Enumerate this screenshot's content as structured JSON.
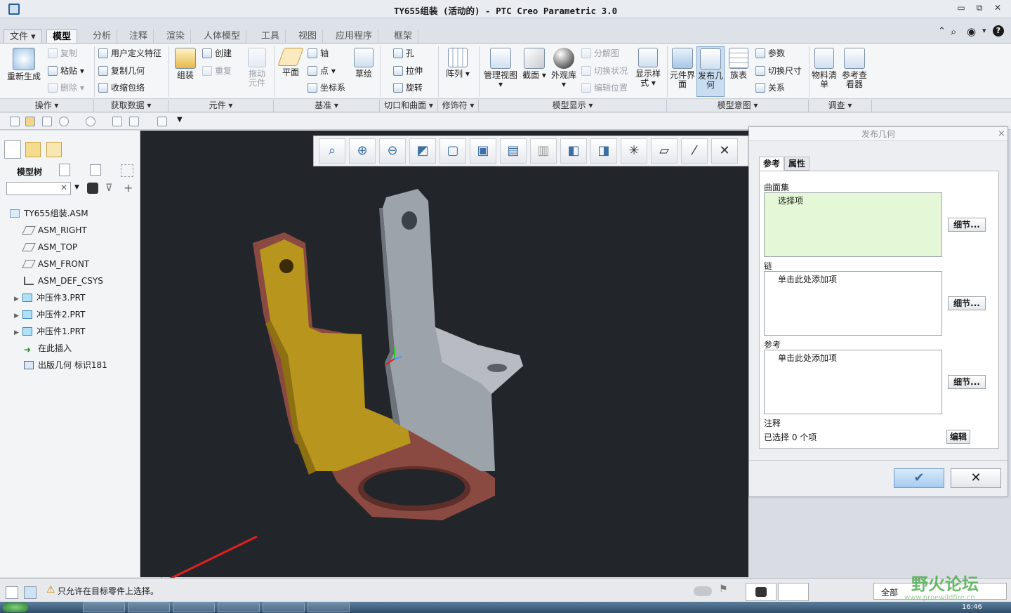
{
  "window": {
    "title": "TY655组装 (活动的) - PTC Creo Parametric 3.0",
    "controls": [
      "▭",
      "⧉",
      "✕"
    ]
  },
  "help_icons": [
    "⌃",
    "⌕",
    "◉",
    "▾",
    "?"
  ],
  "tabs": [
    {
      "label": "文件 ▾"
    },
    {
      "label": "模型"
    },
    {
      "label": "分析"
    },
    {
      "label": "注释"
    },
    {
      "label": "渲染"
    },
    {
      "label": "人体模型"
    },
    {
      "label": "工具"
    },
    {
      "label": "视图"
    },
    {
      "label": "应用程序"
    },
    {
      "label": "框架"
    }
  ],
  "ribbon": {
    "regen": "重新生成",
    "copy": "复制",
    "paste": "粘贴",
    "delete": "删除",
    "udf": "用户定义特征",
    "copy_geom": "复制几何",
    "shrinkwrap": "收缩包络",
    "assemble": "组装",
    "create": "创建",
    "repeat": "重复",
    "drag": "拖动元件",
    "plane": "平面",
    "axis": "轴",
    "point": "点",
    "csys": "坐标系",
    "sketch": "草绘",
    "hole": "孔",
    "extrude": "拉伸",
    "revolve": "旋转",
    "pattern": "阵列",
    "manage_views": "管理视图",
    "section": "截面",
    "appearance": "外观库",
    "explode": "分解图",
    "toggle_status": "切换状况",
    "edit_pos": "编辑位置",
    "display_style": "显示样式",
    "comp_iface": "元件界面",
    "publish_geom": "发布几何",
    "family_table": "族表",
    "params": "参数",
    "toggle_dims": "切换尺寸",
    "relations": "关系",
    "bom": "物料清单",
    "ref_viewer": "参考查看器"
  },
  "groups": [
    "操作 ▾",
    "获取数据 ▾",
    "元件 ▾",
    "基准 ▾",
    "切口和曲面 ▾",
    "修饰符 ▾",
    "模型显示 ▾",
    "模型意图 ▾",
    "调查 ▾"
  ],
  "left_panel": {
    "model_tree_label": "模型树",
    "search_value": "",
    "tree": [
      {
        "label": "TY655组装.ASM",
        "icon": "assembly-icon"
      },
      {
        "label": "ASM_RIGHT",
        "icon": "datum-plane-icon"
      },
      {
        "label": "ASM_TOP",
        "icon": "datum-plane-icon"
      },
      {
        "label": "ASM_FRONT",
        "icon": "datum-plane-icon"
      },
      {
        "label": "ASM_DEF_CSYS",
        "icon": "csys-icon"
      },
      {
        "label": "冲压件3.PRT",
        "icon": "part-icon"
      },
      {
        "label": "冲压件2.PRT",
        "icon": "part-icon"
      },
      {
        "label": "冲压件1.PRT",
        "icon": "part-icon"
      },
      {
        "label": "在此插入",
        "icon": "insert-here-icon"
      },
      {
        "label": "出版几何 标识181",
        "icon": "publish-geom-icon"
      }
    ]
  },
  "dialog": {
    "title": "发布几何",
    "tabs": [
      "参考",
      "属性"
    ],
    "surface_set_label": "曲面集",
    "surface_set_value": "选择项",
    "chain_label": "链",
    "chain_value": "单击此处添加项",
    "refs_label": "参考",
    "refs_value": "单击此处添加项",
    "details_btn": "细节...",
    "note_label": "注释",
    "selected_text": "已选择 0 个项",
    "edit_btn": "编辑",
    "ok": "✔",
    "cancel": "✕",
    "close": "×"
  },
  "status": {
    "message": "只允许在目标零件上选择。",
    "filter_value": "全部",
    "watermark": "野火论坛",
    "watermark_url": "www.proewildfire.cn",
    "clock": "16:46"
  },
  "colors": {
    "viewport": "#22262a",
    "part_brown": "#8a4a42",
    "part_yellow": "#b8951c",
    "part_gray": "#9da3ab",
    "accent": "#3a6ea5",
    "selected_box": "#e4f7d6"
  }
}
